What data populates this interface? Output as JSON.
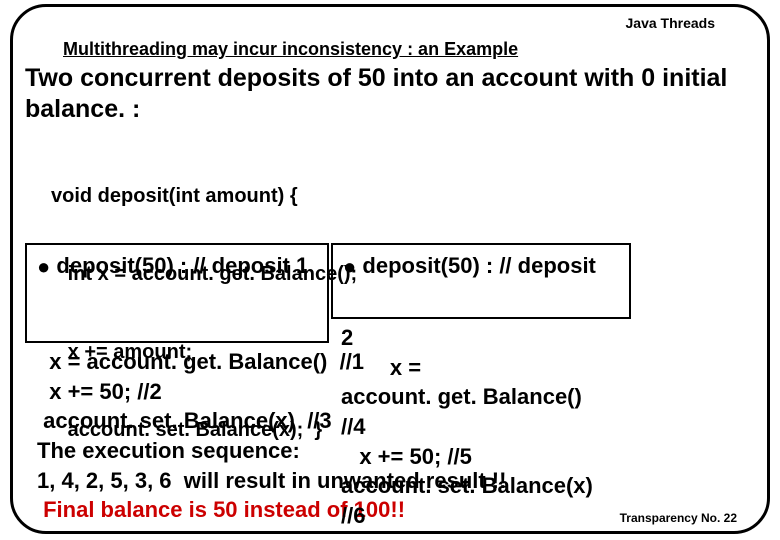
{
  "topic": "Java Threads",
  "heading": "Multithreading  may incur inconsistency : an Example",
  "intro": "Two concurrent deposits of 50 into an account with 0 initial balance. :",
  "code_l1": "void deposit(int amount) {",
  "code_l2": "   int x = account. get. Balance();",
  "code_l3": "   x += amount;",
  "code_l4": "   account. set. Balance(x);  }",
  "box1_text": "deposit(50) :  // deposit 1",
  "box2_text": "deposit(50) : // deposit",
  "left_l1": "  x = account. get. Balance()  //1",
  "left_l2": "  x += 50; //2",
  "left_l3": " account. set. Balance(x)  //3",
  "left_l4": "The execution sequence:",
  "left_l5": "1, 4, 2, 5, 3, 6  will result in unwanted result !!",
  "left_l6": " Final balance is 50 instead of 100!!",
  "right_l0": "2",
  "right_l1": "        x =",
  "right_l2": "account. get. Balance()",
  "right_l3": "//4",
  "right_l4": "   x += 50; //5",
  "right_l5": "account. set. Balance(x)",
  "right_l6": "//6",
  "transparency": "Transparency No. 22"
}
